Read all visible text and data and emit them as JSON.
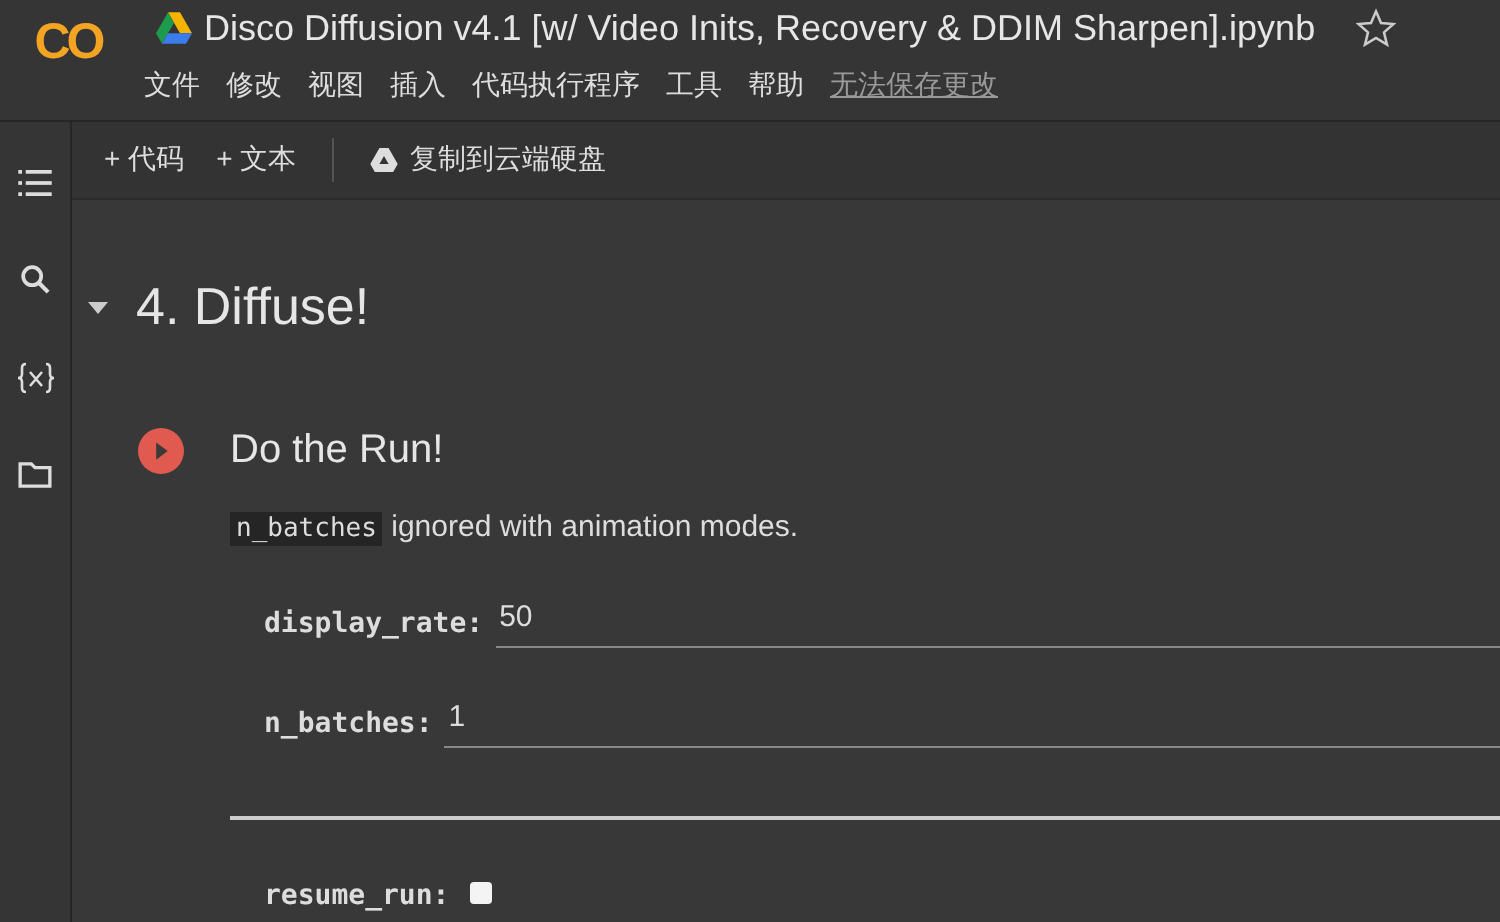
{
  "logo": {
    "text": "CO"
  },
  "title": "Disco Diffusion v4.1 [w/ Video Inits, Recovery & DDIM Sharpen].ipynb",
  "menu": [
    {
      "label": "文件",
      "kind": "menu"
    },
    {
      "label": "修改",
      "kind": "menu"
    },
    {
      "label": "视图",
      "kind": "menu"
    },
    {
      "label": "插入",
      "kind": "menu"
    },
    {
      "label": "代码执行程序",
      "kind": "menu"
    },
    {
      "label": "工具",
      "kind": "menu"
    },
    {
      "label": "帮助",
      "kind": "menu"
    },
    {
      "label": "无法保存更改",
      "kind": "link"
    }
  ],
  "toolbar": [
    {
      "label": "+ 代码",
      "kind": "add"
    },
    {
      "label": "+ 文本",
      "kind": "add"
    },
    {
      "label": "复制到云端硬盘",
      "kind": "drive"
    }
  ],
  "section": {
    "title": "4. Diffuse!",
    "expanded": true
  },
  "cell": {
    "title": "Do the Run!",
    "note_code": "n_batches",
    "note_text": "ignored with animation modes.",
    "fields": [
      {
        "kind": "text",
        "label": "display_rate:",
        "value": "50"
      },
      {
        "kind": "text",
        "label": "n_batches:",
        "value": "1"
      },
      {
        "kind": "rule"
      },
      {
        "kind": "checkbox",
        "label": "resume_run:",
        "checked": false
      }
    ]
  }
}
